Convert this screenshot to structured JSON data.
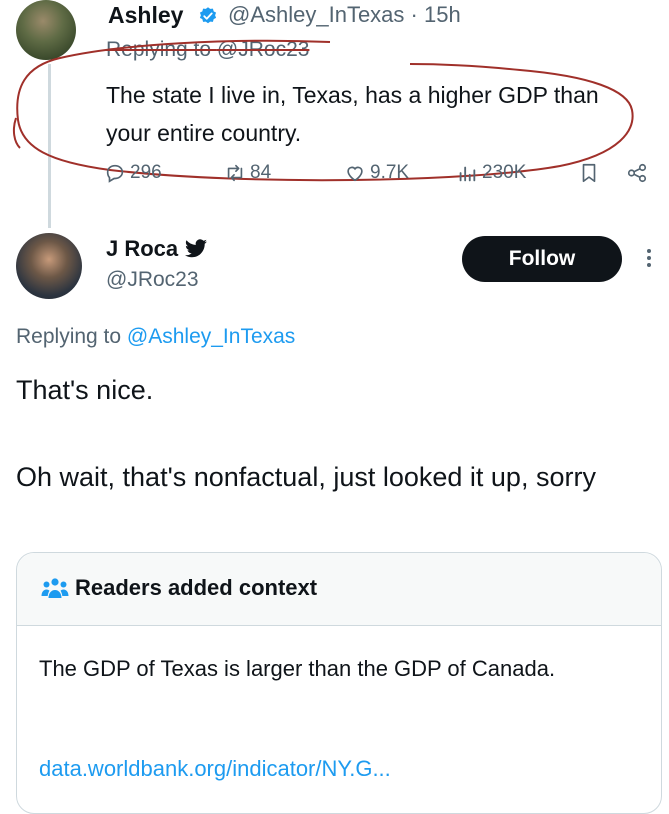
{
  "tweet1": {
    "author_name": "Ashley",
    "handle_time": "@Ashley_InTexas · 15h",
    "replying_prefix": "Replying to ",
    "replying_handle": "@JRoc23",
    "text": "The state I live in, Texas, has a higher GDP than your entire country.",
    "actions": {
      "replies": "296",
      "retweets": "84",
      "likes": "9.7K",
      "views": "230K"
    }
  },
  "tweet2": {
    "author_name": "J Roca",
    "handle": "@JRoc23",
    "follow_label": "Follow",
    "replying_prefix": "Replying to ",
    "replying_handle": "@Ashley_InTexas",
    "line1": "That's nice.",
    "line2": "Oh wait, that's nonfactual, just looked it up, sorry"
  },
  "context_card": {
    "title": "Readers added context",
    "text": "The GDP of Texas is larger than the GDP of Canada.",
    "link": "data.worldbank.org/indicator/NY.G..."
  },
  "colors": {
    "text": "#0f1419",
    "muted": "#536471",
    "link": "#1d9bf0",
    "verified": "#1d9bf0",
    "annotation_red": "#a0302a"
  }
}
